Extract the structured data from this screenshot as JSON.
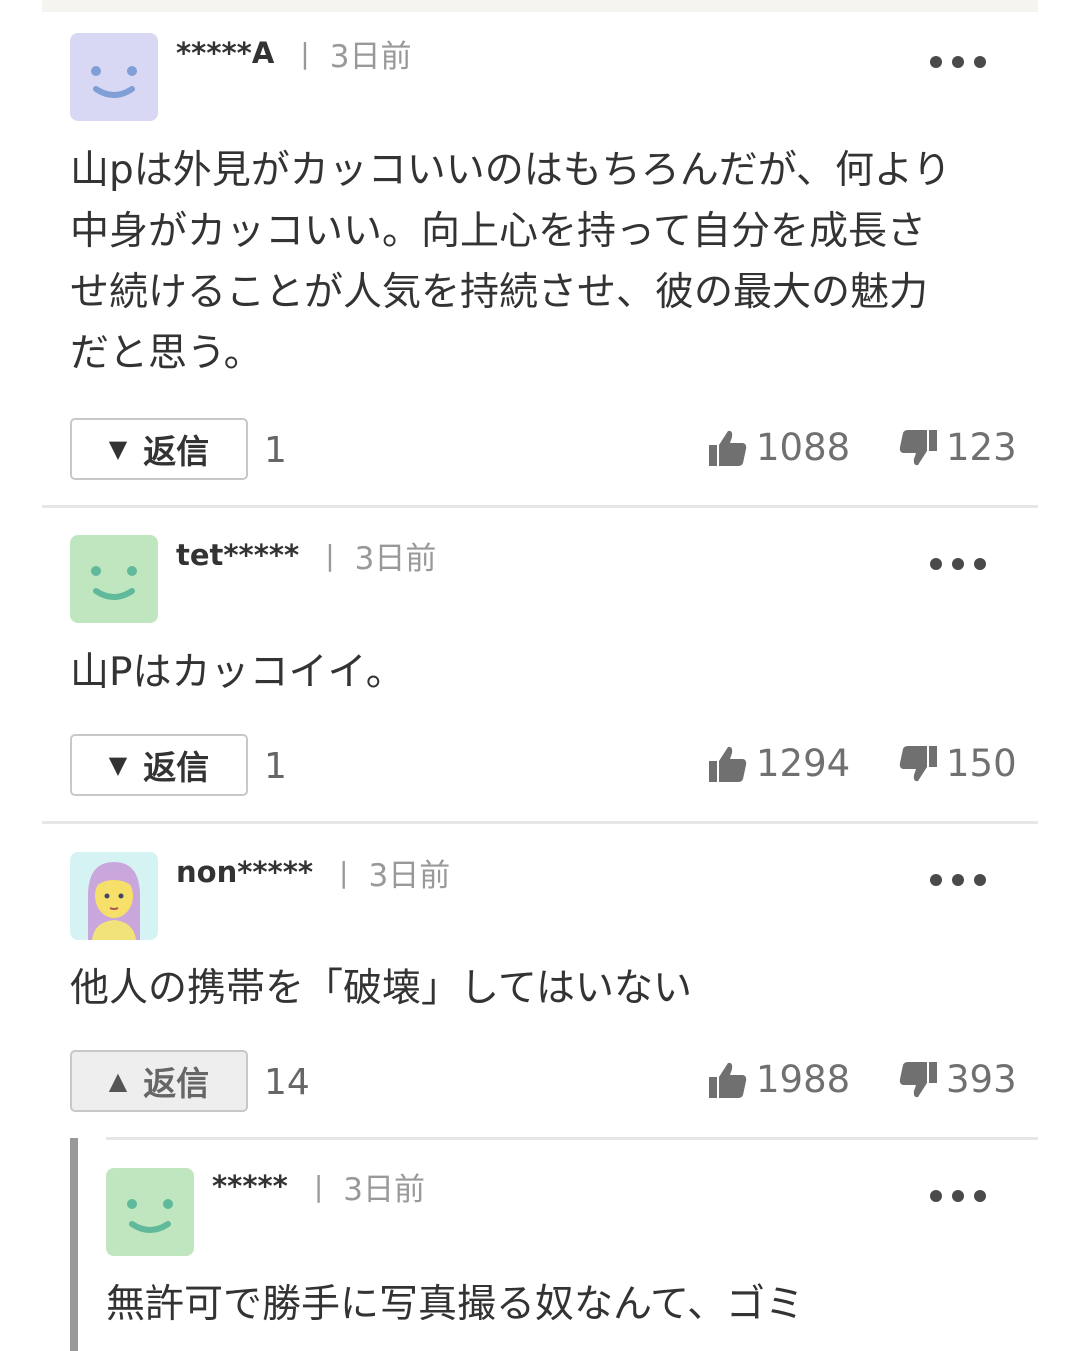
{
  "comments": [
    {
      "user": "*****A",
      "separator": "|",
      "time": "3日前",
      "body": "山pは外見がカッコいいのはもちろんだが、何より\n中身がカッコいい。向上心を持って自分を成長さ\nせ続けることが人気を持続させ、彼の最大の魅力\nだと思う。",
      "reply_label": "返信",
      "reply_icon": "triangle-down",
      "reply_count": "1",
      "likes": "1088",
      "dislikes": "123",
      "avatar_color": "#d8d8f4",
      "face_color": "#7f9fd6"
    },
    {
      "user": "tet*****",
      "separator": "|",
      "time": "3日前",
      "body": "山Pはカッコイイ。",
      "reply_label": "返信",
      "reply_icon": "triangle-down",
      "reply_count": "1",
      "likes": "1294",
      "dislikes": "150",
      "avatar_color": "#bfe6bf",
      "face_color": "#5fb99a"
    },
    {
      "user": "non*****",
      "separator": "|",
      "time": "3日前",
      "body": "他人の携帯を「破壊」してはいない",
      "reply_label": "返信",
      "reply_icon": "triangle-up",
      "reply_count": "14",
      "likes": "1988",
      "dislikes": "393",
      "avatar_color": "#d6f3f3",
      "face_color": "#f6e06a"
    }
  ],
  "reply": {
    "user": "*****",
    "separator": "|",
    "time": "3日前",
    "body": "無許可で勝手に写真撮る奴なんて、ゴミ",
    "avatar_color": "#bfe6bf",
    "face_color": "#5fb99a"
  },
  "colors": {
    "text": "#333333",
    "muted": "#999999",
    "divider": "#e6e6e6"
  },
  "icons": [
    "more-dots-icon",
    "thumbs-up-icon",
    "thumbs-down-icon",
    "triangle-down-icon",
    "triangle-up-icon"
  ]
}
